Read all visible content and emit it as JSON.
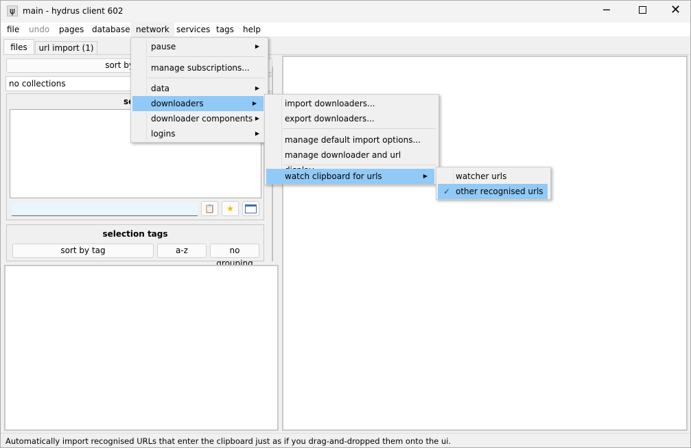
{
  "window": {
    "title": "main - hydrus client 602",
    "app_icon": "psi-icon"
  },
  "menubar": [
    "file",
    "undo",
    "pages",
    "database",
    "network",
    "services",
    "tags",
    "help"
  ],
  "tabs": [
    "files",
    "url import (1)"
  ],
  "left": {
    "sort_label": "sort by file: filesi",
    "collections": "no collections",
    "search_header": "se",
    "selection_tags": "selection tags",
    "sort_by_tag": "sort by tag",
    "az": "a-z",
    "grouping": "no grouping"
  },
  "network_menu": {
    "pause": "pause",
    "manage_subscriptions": "manage subscriptions...",
    "data": "data",
    "downloaders": "downloaders",
    "downloader_components": "downloader components",
    "logins": "logins"
  },
  "downloaders_menu": {
    "import": "import downloaders...",
    "export": "export downloaders...",
    "manage_default": "manage default import options...",
    "manage_display": "manage downloader and url display...",
    "watch_clipboard": "watch clipboard for urls"
  },
  "clipboard_menu": {
    "watcher": "watcher urls",
    "other": "other recognised urls",
    "other_checked": true,
    "check": "✓"
  },
  "status": "Automatically import recognised URLs that enter the clipboard just as if you drag-and-dropped them onto the ui.",
  "colors": {
    "highlight": "#91c9f7",
    "search_input": "#eaf6fd"
  }
}
